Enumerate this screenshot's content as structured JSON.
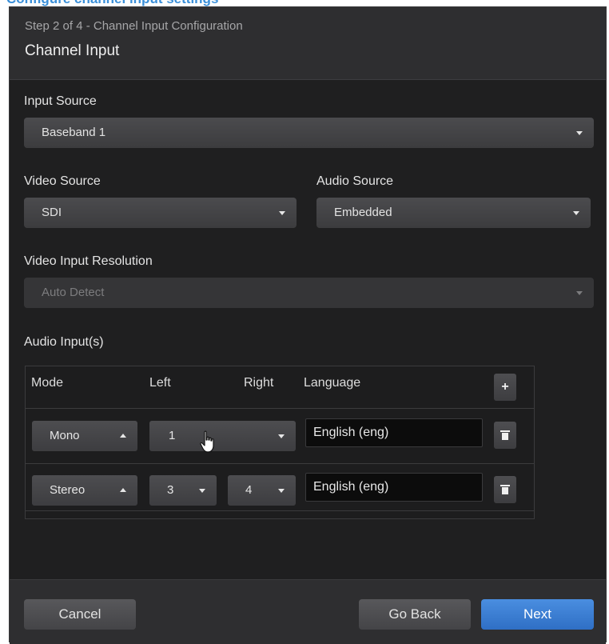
{
  "page_caption": "Configure channel input settings",
  "header": {
    "step": "Step 2 of 4 - Channel Input Configuration",
    "title": "Channel Input"
  },
  "input_source": {
    "label": "Input Source",
    "value": "Baseband 1"
  },
  "video_source": {
    "label": "Video Source",
    "value": "SDI"
  },
  "audio_source": {
    "label": "Audio Source",
    "value": "Embedded"
  },
  "video_resolution": {
    "label": "Video Input Resolution",
    "value": "Auto Detect",
    "disabled": true
  },
  "audio_inputs": {
    "label": "Audio Input(s)",
    "columns": [
      "Mode",
      "Left",
      "Right",
      "Language"
    ],
    "add_icon": "plus-icon",
    "delete_icon": "trash-icon",
    "rows": [
      {
        "mode": "Mono",
        "left": "1",
        "right": "",
        "language": "English (eng)"
      },
      {
        "mode": "Stereo",
        "left": "3",
        "right": "4",
        "language": "English (eng)"
      }
    ]
  },
  "footer": {
    "cancel": "Cancel",
    "go_back": "Go Back",
    "next": "Next"
  },
  "colors": {
    "accent": "#3b7fd6",
    "dialog_bg": "#2b2b2c",
    "body_bg": "#1f1f20"
  }
}
